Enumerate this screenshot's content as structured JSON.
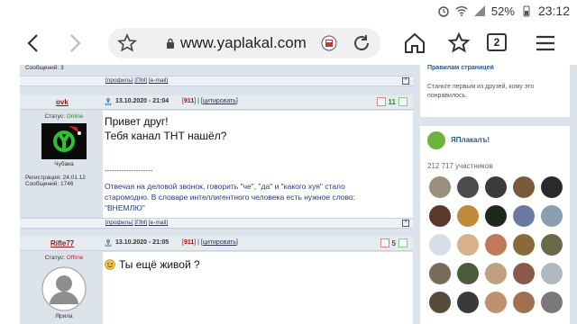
{
  "status_bar": {
    "battery": "52%",
    "time": "23:12"
  },
  "browser": {
    "url": "www.yaplakal.com",
    "tabs_count": "2"
  },
  "forum": {
    "prev_signature": "Сообщений: 3",
    "bar_links": [
      "[профиль]",
      "[ПМ]",
      "[e-mail]"
    ],
    "posts": [
      {
        "author": "ovk",
        "datetime": "13.10.2020 - 21:04",
        "post_num": "911",
        "quote_label": "цитировать",
        "score": "11",
        "status_label": "Статус:",
        "status": "Online",
        "caption": "Чубака",
        "reg": "Регистрация: 24.01.12",
        "messages": "Сообщений: 1746",
        "lines": [
          "Привет друг!",
          "Тебя канал ТНТ нашёл?"
        ],
        "separator": "--------------------",
        "signature": "Отвечая на деловой звонок, говорить \"че\", \"да\" и \"какого хуя\" стало старомодно. В словаре интеллигентного человека есть нужное слово: \"ВНЕМЛЮ\""
      },
      {
        "author": "Rifle77",
        "datetime": "13.10.2020 - 21:05",
        "post_num": "911",
        "quote_label": "цитировать",
        "score": "5",
        "status_label": "Статус:",
        "status": "Offline",
        "caption": "Ярила",
        "lines": [
          "Ты ещё живой ?"
        ]
      }
    ]
  },
  "sidebar": {
    "top_banner": "Правилам страницей",
    "top_text": "Станьте первым из друзей, кому это понравилось.",
    "group_name": "ЯПлакалъ!",
    "members": "212 717 участников"
  },
  "colors": {
    "avatars": [
      "#9a8e7c",
      "#4b4b4b",
      "#3b3b3b",
      "#7a5a3a",
      "#2a2a2a",
      "#5a3a2a",
      "#c08a3a",
      "#1c2a1c",
      "#6a7aa0",
      "#8aa0b0",
      "#d6dde6",
      "#d8b08a",
      "#c07a5a",
      "#8a6a3a",
      "#6a6a4a",
      "#7a6a5a",
      "#4a5a3a",
      "#c0a080",
      "#8a5a4a",
      "#b0b8c0",
      "#5a4a3a",
      "#3a3a3a",
      "#c09070",
      "#a07050",
      "#7a7a7a"
    ]
  }
}
